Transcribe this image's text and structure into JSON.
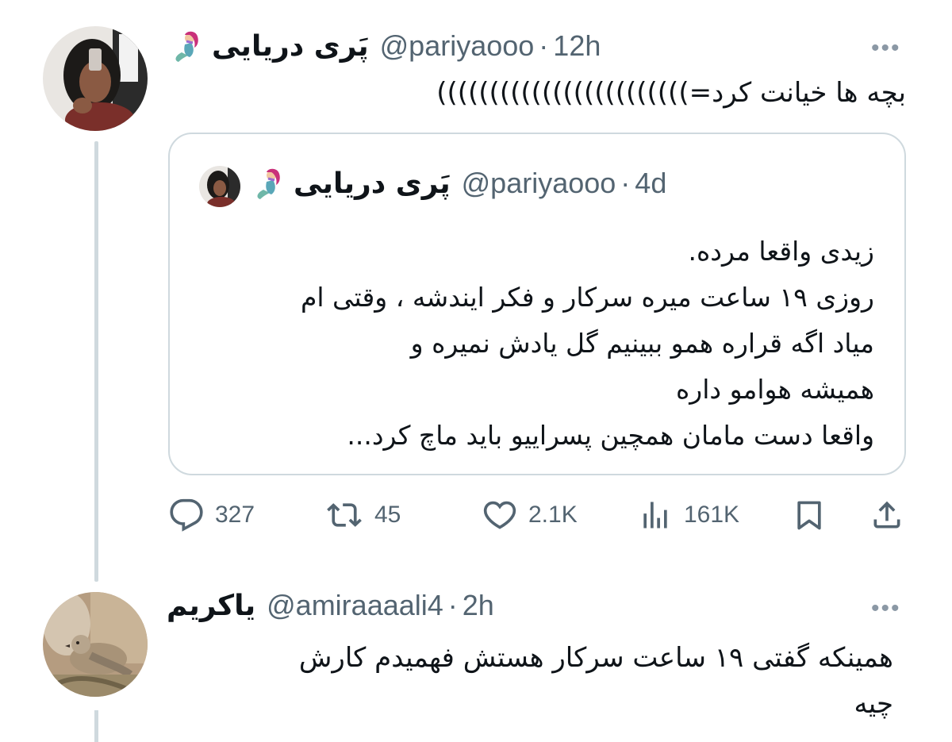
{
  "main_tweet": {
    "display_name": "پَری دریایی",
    "handle": "@pariyaooo",
    "dot": "·",
    "time": "12h",
    "more": "•••",
    "text": "بچه ها خیانت کرد=))))))))))))))))))))))))",
    "emoji": "mermaid-emoji"
  },
  "quote_tweet": {
    "display_name": "پَری دریایی",
    "handle": "@pariyaooo",
    "dot": "·",
    "time": "4d",
    "lines": [
      "زیدی واقعا مرده.",
      "روزی ۱۹ ساعت میره سرکار و فکر ایندشه ، وقتی ام",
      "میاد اگه قراره همو ببینیم گل یادش نمیره و",
      "همیشه هوامو داره",
      "واقعا دست مامان همچین پسراییو باید ماچ کرد..."
    ]
  },
  "actions": {
    "replies": "327",
    "retweets": "45",
    "likes": "2.1K",
    "views": "161K",
    "icons": [
      "reply-icon",
      "retweet-icon",
      "like-icon",
      "views-icon",
      "bookmark-icon",
      "share-icon"
    ]
  },
  "reply_tweet": {
    "display_name": "یاکریم",
    "handle": "@amiraaaali4",
    "dot": "·",
    "time": "2h",
    "more": "•••",
    "lines": [
      "همینکه گفتی ۱۹ ساعت سرکار هستش فهمیدم کارش",
      "چیه"
    ]
  },
  "colors": {
    "text": "#0f1419",
    "secondary": "#536471",
    "border": "#cfd9de"
  }
}
